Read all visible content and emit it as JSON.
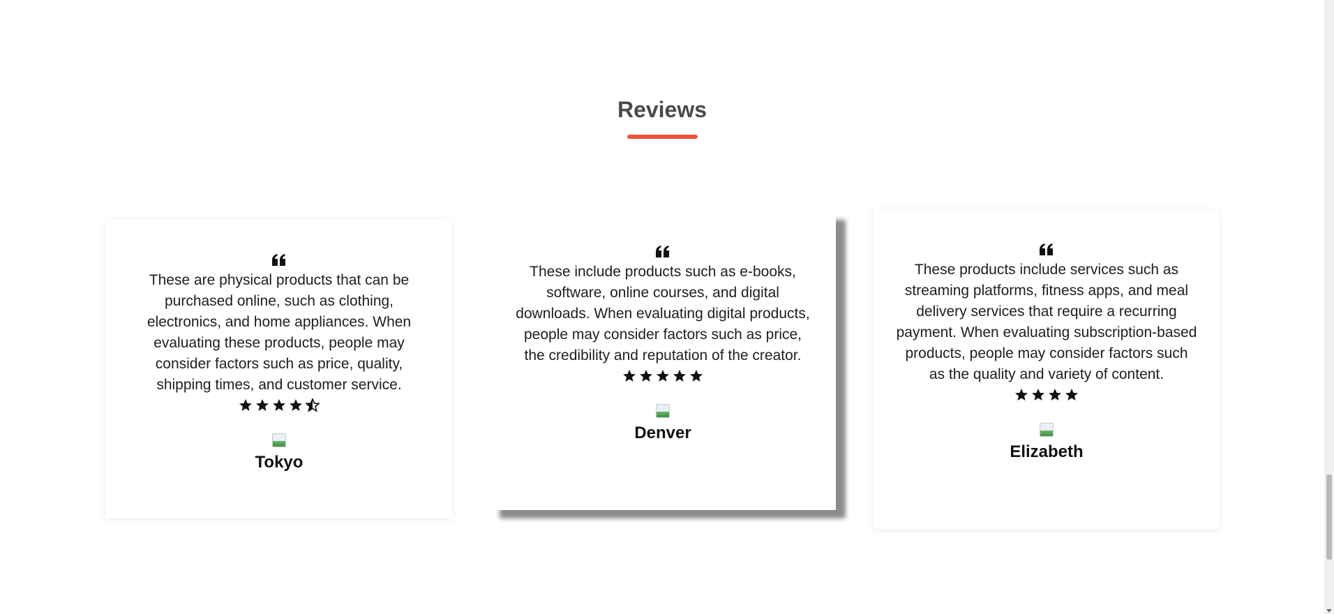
{
  "section": {
    "title": "Reviews",
    "accent_color": "#f0513b"
  },
  "icons": {
    "quote": "quote-left-icon",
    "star": "star-icon",
    "half_star": "star-half-icon",
    "avatar": "broken-image-icon"
  },
  "reviews": [
    {
      "text": "These are physical products that can be purchased online, such as clothing, electronics, and home appliances. When evaluating these products, people may consider factors such as price, quality, shipping times, and customer service.",
      "rating": 4.5,
      "name": "Tokyo"
    },
    {
      "text": "These include products such as e-books, software, online courses, and digital downloads. When evaluating digital products, people may consider factors such as price, the credibility and reputation of the creator.",
      "rating": 5,
      "name": "Denver"
    },
    {
      "text": "These products include services such as streaming platforms, fitness apps, and meal delivery services that require a recurring payment. When evaluating subscription-based products, people may consider factors such as the quality and variety of content.",
      "rating": 4,
      "name": "Elizabeth"
    }
  ]
}
